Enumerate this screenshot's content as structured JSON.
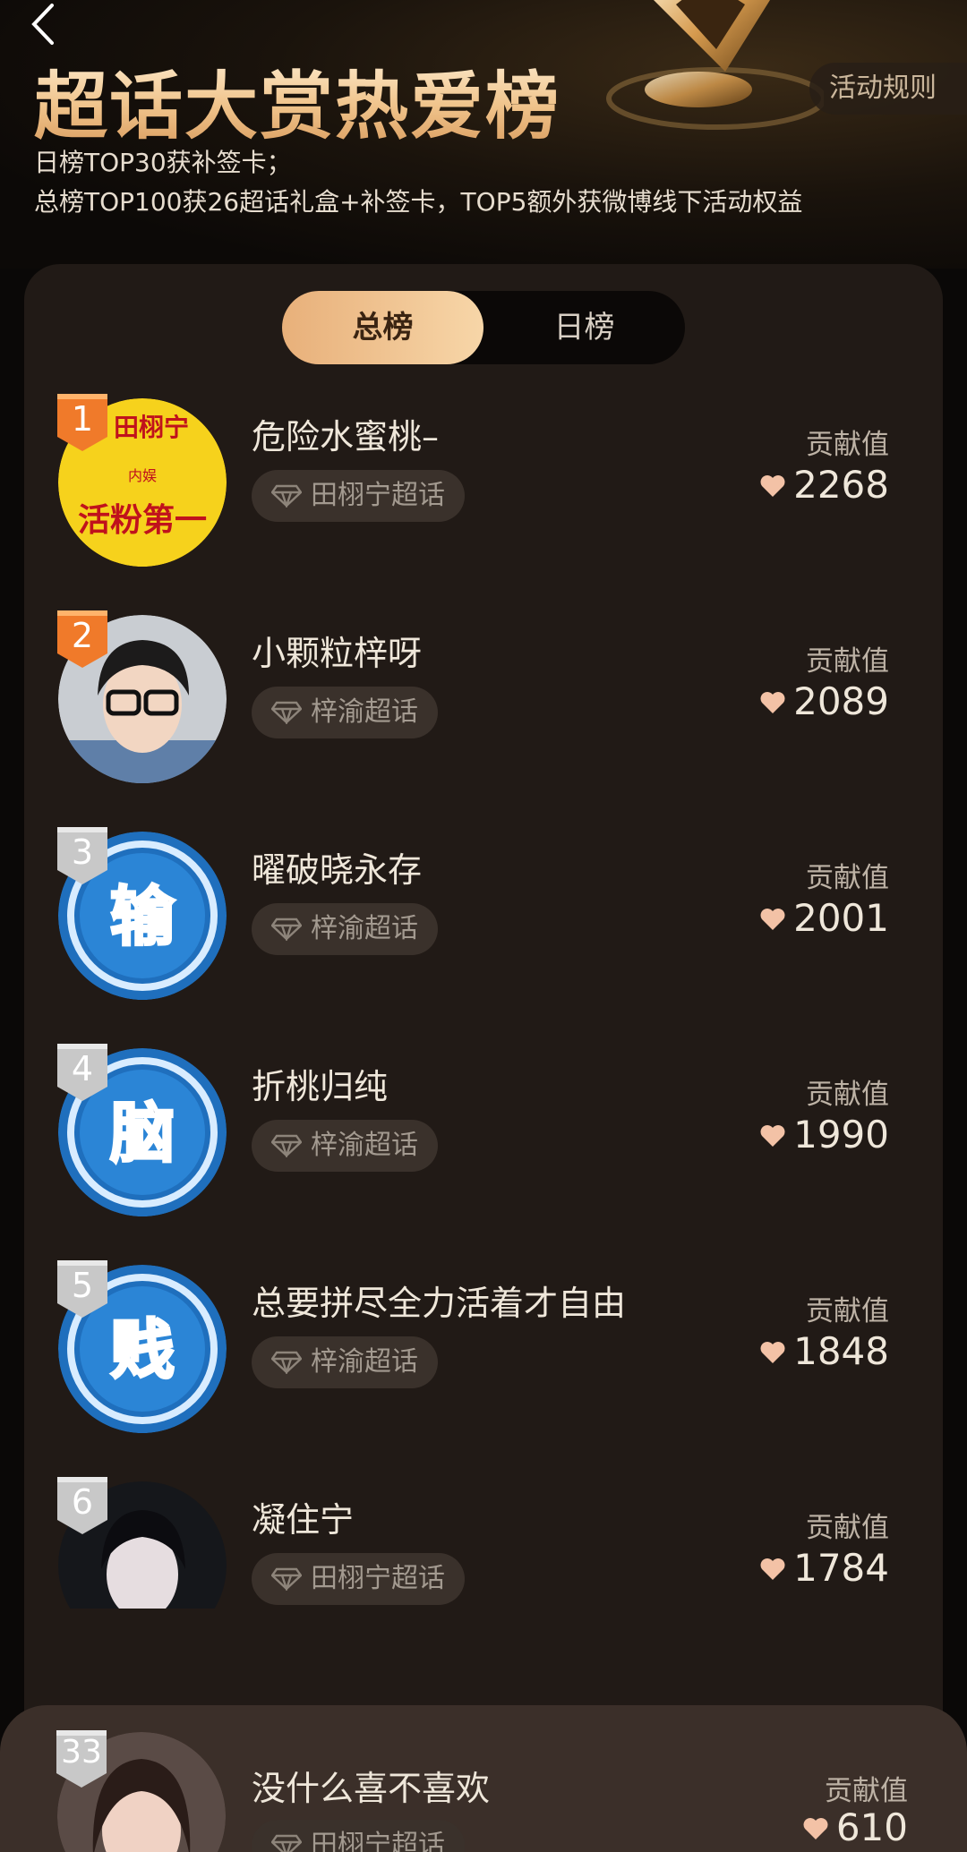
{
  "header": {
    "title": "超话大赏热爱榜",
    "rules_label": "活动规则",
    "subtitle_line1": "日榜TOP30获补签卡；",
    "subtitle_line2": "总榜TOP100获26超话礼盒+补签卡，TOP5额外获微博线下活动权益"
  },
  "tabs": [
    {
      "label": "总榜",
      "active": true
    },
    {
      "label": "日榜",
      "active": false
    }
  ],
  "ranking": [
    {
      "rank": "1",
      "name": "危险水蜜桃–",
      "topic": "田栩宁超话",
      "score_label": "贡献值",
      "score": "2268"
    },
    {
      "rank": "2",
      "name": "小颗粒梓呀",
      "topic": "梓渝超话",
      "score_label": "贡献值",
      "score": "2089"
    },
    {
      "rank": "3",
      "name": "曜破晓永存",
      "topic": "梓渝超话",
      "score_label": "贡献值",
      "score": "2001"
    },
    {
      "rank": "4",
      "name": "折桃归纯",
      "topic": "梓渝超话",
      "score_label": "贡献值",
      "score": "1990"
    },
    {
      "rank": "5",
      "name": "总要拼尽全力活着才自由",
      "topic": "梓渝超话",
      "score_label": "贡献值",
      "score": "1848"
    },
    {
      "rank": "6",
      "name": "凝住宁",
      "topic": "田栩宁超话",
      "score_label": "贡献值",
      "score": "1784"
    }
  ],
  "my_rank": {
    "rank": "33",
    "name": "没什么喜不喜欢",
    "topic": "田栩宁超话",
    "score_label": "贡献值",
    "score": "610"
  },
  "avatars": {
    "avatar1_texts": [
      "田栩宁",
      "内娱",
      "活粉第一"
    ],
    "avatar3_char": "输",
    "avatar4_char": "脑",
    "avatar5_char": "贱"
  },
  "colors": {
    "accent_gold": "#f0c48c",
    "badge_gold_orange": "#f07a2a",
    "badge_silver": "#c8c8c8",
    "heart": "#f3c2a6",
    "card_bg": "#211a16"
  }
}
